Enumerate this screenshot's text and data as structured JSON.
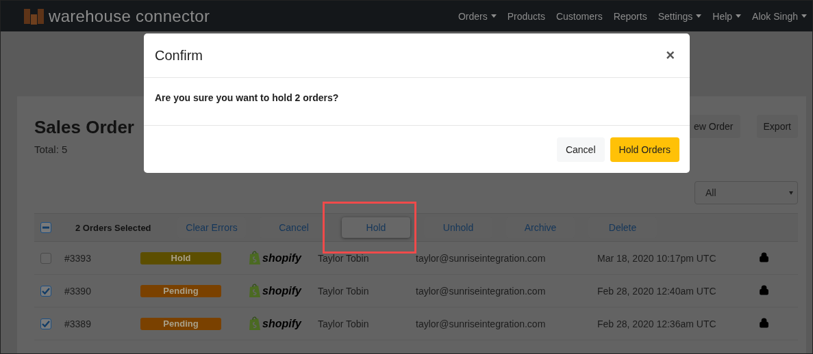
{
  "navbar": {
    "brand": "warehouse connector",
    "items": [
      {
        "label": "Orders",
        "dropdown": true
      },
      {
        "label": "Products",
        "dropdown": false
      },
      {
        "label": "Customers",
        "dropdown": false
      },
      {
        "label": "Reports",
        "dropdown": false
      },
      {
        "label": "Settings",
        "dropdown": true
      },
      {
        "label": "Help",
        "dropdown": true
      },
      {
        "label": "Alok Singh",
        "dropdown": true
      }
    ]
  },
  "page": {
    "title": "Sales Order",
    "total": "Total: 5",
    "buttons": [
      "ew Order",
      "Export"
    ],
    "filter": {
      "value": "All"
    }
  },
  "bulk_bar": {
    "select_all": {
      "mixed": true
    },
    "selected_text": "2 Orders Selected",
    "actions": [
      {
        "label": "Clear Errors",
        "focused": false
      },
      {
        "label": "Cancel",
        "focused": false
      },
      {
        "label": "Hold",
        "focused": true,
        "annotated": true
      },
      {
        "label": "Unhold",
        "focused": false
      },
      {
        "label": "Archive",
        "focused": false
      },
      {
        "label": "Delete",
        "focused": false
      }
    ]
  },
  "orders": [
    {
      "checked": false,
      "number": "#3393",
      "status": {
        "label": "Hold",
        "color": "#5c4e00"
      },
      "store": "shopify",
      "name": "Taylor Tobin",
      "email": "taylor@sunriseintegration.com",
      "date": "Mar 18, 2020 10:17pm UTC",
      "locked": true
    },
    {
      "checked": true,
      "number": "#3390",
      "status": {
        "label": "Pending",
        "color": "#7a4100"
      },
      "store": "shopify",
      "name": "Taylor Tobin",
      "email": "taylor@sunriseintegration.com",
      "date": "Feb 28, 2020 12:40am UTC",
      "locked": true
    },
    {
      "checked": true,
      "number": "#3389",
      "status": {
        "label": "Pending",
        "color": "#7a4100"
      },
      "store": "shopify",
      "name": "Taylor Tobin",
      "email": "taylor@sunriseintegration.com",
      "date": "Feb 28, 2020 12:36am UTC",
      "locked": true
    }
  ],
  "dialog": {
    "title": "Confirm",
    "close": "×",
    "message": "Are you sure you want to hold 2 orders?",
    "buttons": [
      {
        "label": "Cancel",
        "kind": "secondary"
      },
      {
        "label": "Hold Orders",
        "kind": "primary"
      }
    ]
  }
}
